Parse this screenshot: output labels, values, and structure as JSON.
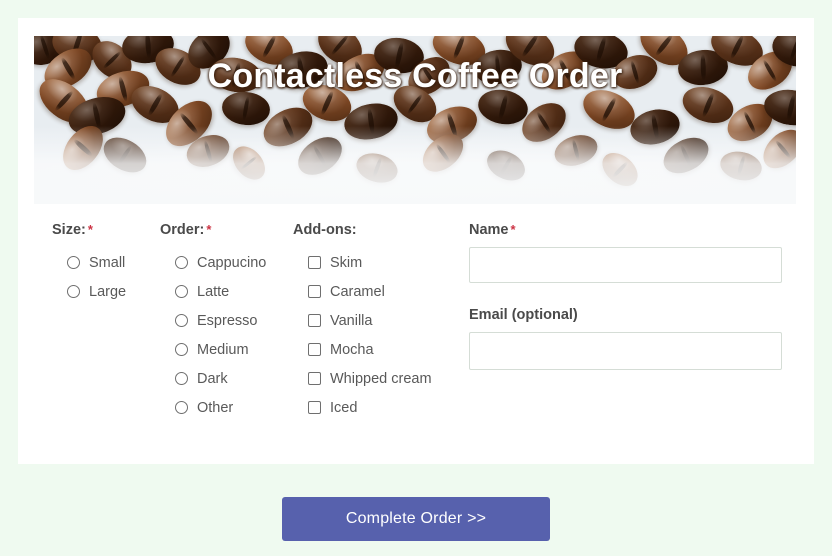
{
  "page": {
    "background_color": "#effaf0",
    "card_background": "#ffffff"
  },
  "header": {
    "title": "Contactless Coffee Order",
    "image": "coffee-beans-banner",
    "title_color": "#ffffff"
  },
  "form": {
    "required_marker": "*",
    "groups": [
      {
        "name": "size",
        "label": "Size:",
        "required": true,
        "type": "radio",
        "options": [
          {
            "label": "Small",
            "checked": false
          },
          {
            "label": "Large",
            "checked": false
          }
        ]
      },
      {
        "name": "order",
        "label": "Order:",
        "required": true,
        "type": "radio",
        "options": [
          {
            "label": "Cappucino",
            "checked": false
          },
          {
            "label": "Latte",
            "checked": false
          },
          {
            "label": "Espresso",
            "checked": false
          },
          {
            "label": "Medium",
            "checked": false
          },
          {
            "label": "Dark",
            "checked": false
          },
          {
            "label": "Other",
            "checked": false
          }
        ]
      },
      {
        "name": "addons",
        "label": "Add-ons:",
        "required": false,
        "type": "checkbox",
        "options": [
          {
            "label": "Skim",
            "checked": false
          },
          {
            "label": "Caramel",
            "checked": false
          },
          {
            "label": "Vanilla",
            "checked": false
          },
          {
            "label": "Mocha",
            "checked": false
          },
          {
            "label": "Whipped cream",
            "checked": false
          },
          {
            "label": "Iced",
            "checked": false
          }
        ]
      }
    ],
    "fields": {
      "name": {
        "label": "Name",
        "required": true,
        "value": "",
        "placeholder": ""
      },
      "email": {
        "label": "Email (optional)",
        "required": false,
        "value": "",
        "placeholder": ""
      }
    },
    "submit": {
      "label": "Complete Order >>",
      "color": "#5761ad",
      "text_color": "#ffffff"
    }
  },
  "colors": {
    "required_asterisk": "#cc3344",
    "label_text": "#4a4a4a",
    "option_text": "#595959",
    "input_border": "#d5ddd6"
  }
}
